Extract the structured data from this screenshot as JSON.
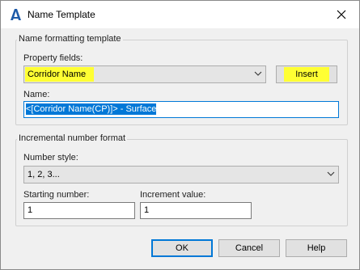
{
  "window": {
    "title": "Name Template",
    "icon": "autocad-a-icon",
    "close_icon": "close-icon"
  },
  "naming_group": {
    "label": "Name formatting template",
    "property_fields_label": "Property fields:",
    "property_fields_value": "Corridor Name",
    "insert_label": "Insert",
    "name_label": "Name:",
    "name_value": "<[Corridor Name(CP)]> - Surface"
  },
  "increment_group": {
    "label": "Incremental number format",
    "number_style_label": "Number style:",
    "number_style_value": "1, 2, 3...",
    "starting_number_label": "Starting number:",
    "starting_number_value": "1",
    "increment_value_label": "Increment value:",
    "increment_value_value": "1"
  },
  "buttons": {
    "ok": "OK",
    "cancel": "Cancel",
    "help": "Help"
  },
  "colors": {
    "highlight": "#ffff33",
    "accent": "#0078d7",
    "icon_blue": "#1e5ba8"
  }
}
